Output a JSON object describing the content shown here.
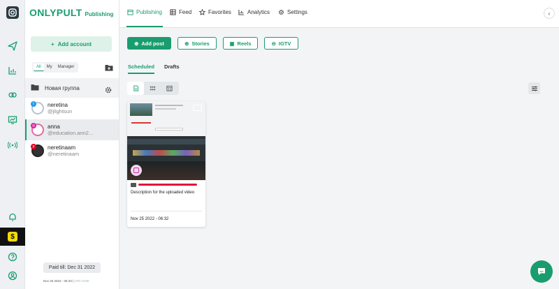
{
  "brand": {
    "name": "ONLYPULT",
    "product": "Publishing"
  },
  "colors": {
    "accent": "#1a9d6e",
    "rail": "#eef0f3",
    "highlight": "#f5d90a"
  },
  "rail": {
    "icons": [
      "instagram-logo-icon",
      "send-icon",
      "bar-chart-icon",
      "link-icon",
      "monitor-chart-icon",
      "broadcast-icon",
      "bell-icon",
      "dollar-icon",
      "help-icon",
      "user-icon"
    ]
  },
  "accounts_panel": {
    "add_account_label": "Add account",
    "filters": [
      "All",
      "My",
      "Manager"
    ],
    "group_name": "Новая группа",
    "accounts": [
      {
        "name": "neretina",
        "handle": "@jlightsun",
        "network": "twitter"
      },
      {
        "name": "anna",
        "handle": "@education.ann2...",
        "network": "instagram"
      },
      {
        "name": "neretinaam",
        "handle": "@neretinaam",
        "network": "pinterest"
      }
    ],
    "paid_till": "Paid till: Dec 31 2022",
    "footer_time": "Nov 25 2022 - 06:33 |",
    "footer_tz": "UTC+3:00"
  },
  "topnav": {
    "items": [
      "Publishing",
      "Feed",
      "Favorites",
      "Analytics",
      "Settings"
    ],
    "collapse_glyph": "‹"
  },
  "actions": {
    "add_post": "Add post",
    "stories": "Stories",
    "reels": "Reels",
    "igtv": "IGTV"
  },
  "tabs": [
    "Scheduled",
    "Drafts"
  ],
  "post_card": {
    "description": "Description for the uploaded video",
    "date": "Nov 25 2022 - 06:32"
  }
}
